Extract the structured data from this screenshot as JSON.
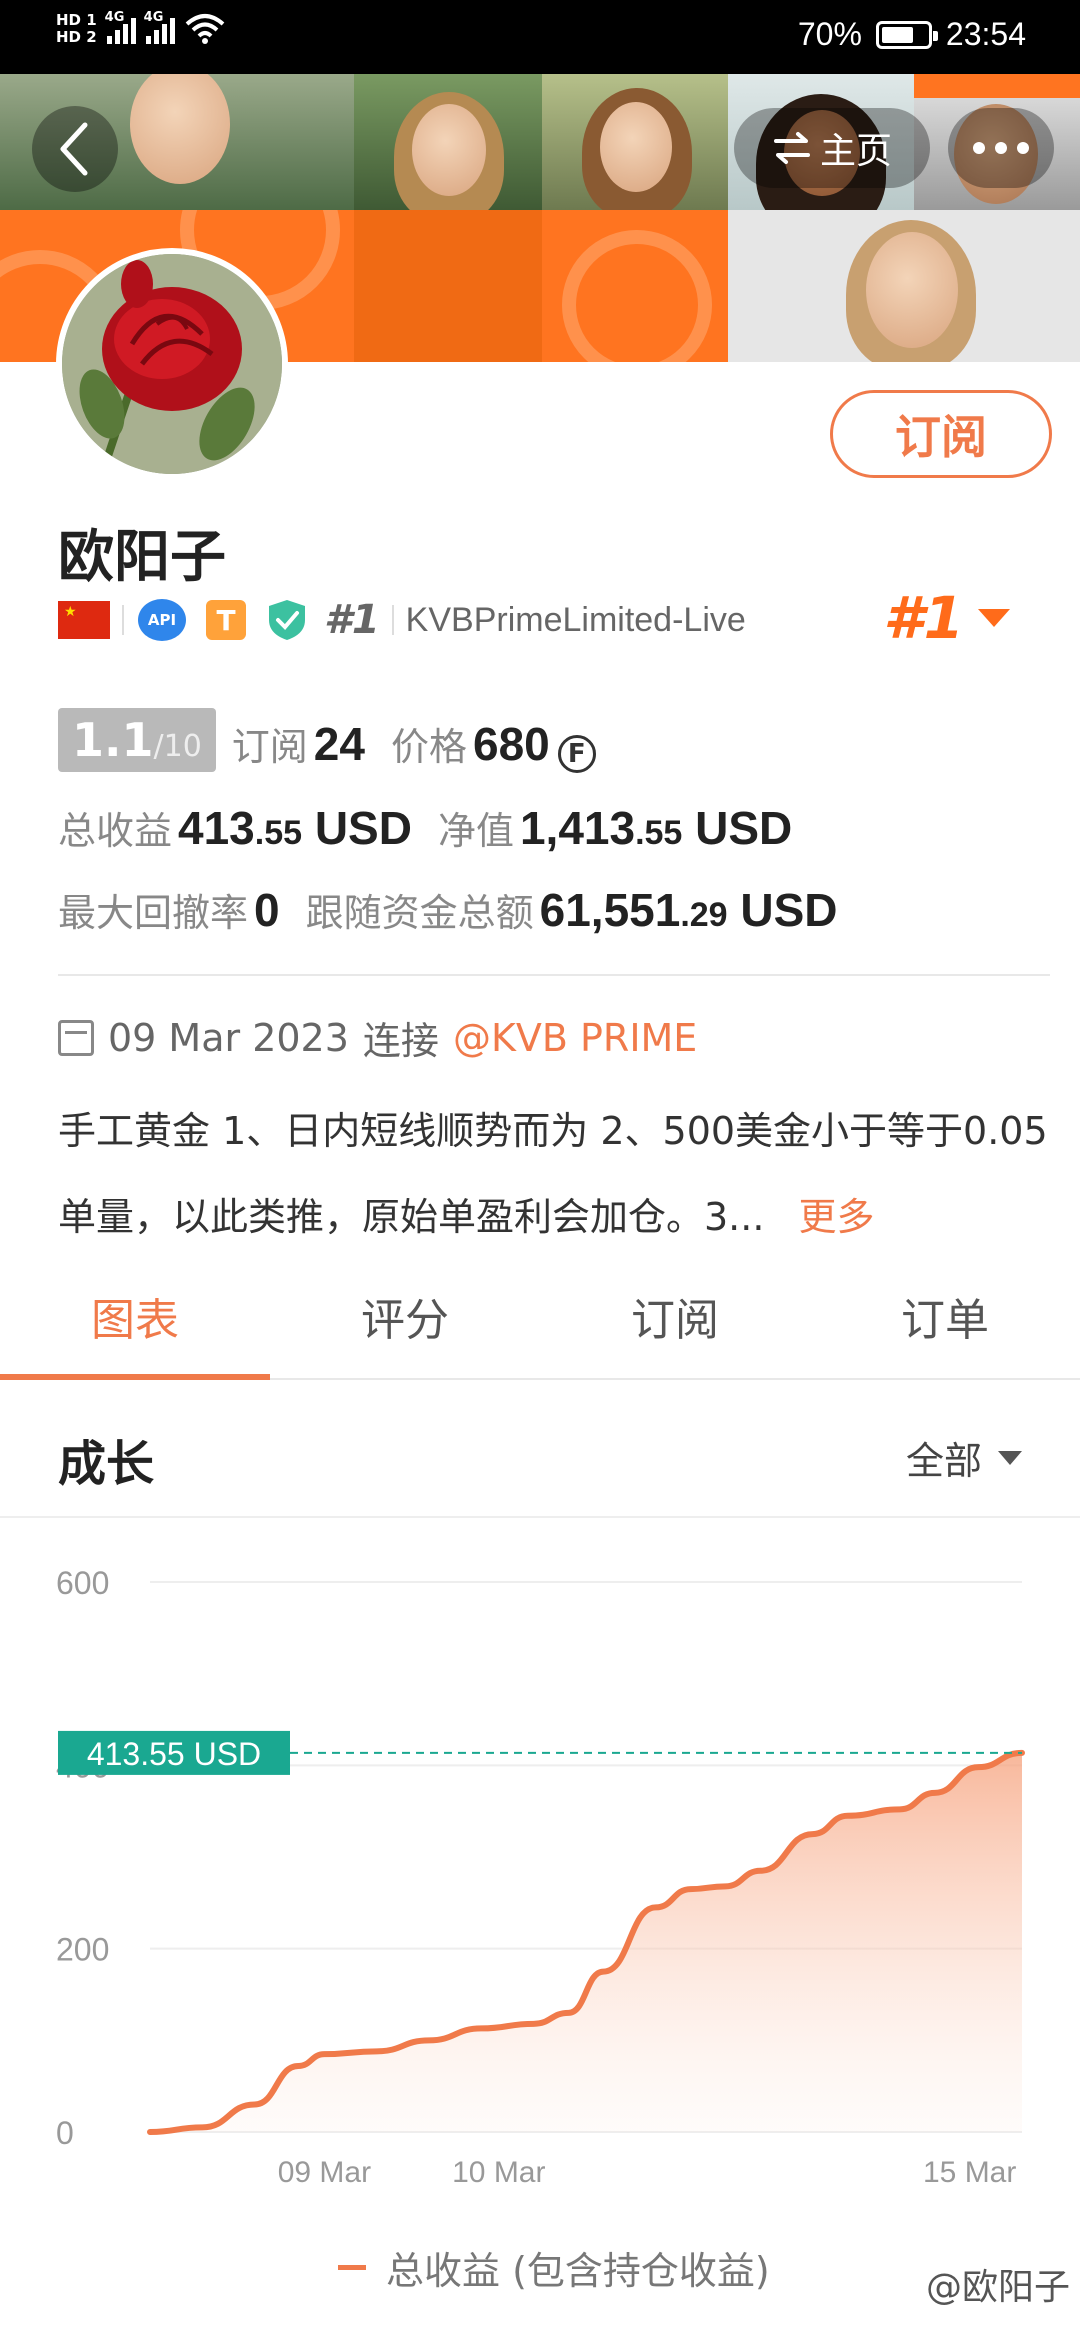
{
  "status_bar": {
    "battery": "70%",
    "time": "23:54",
    "net1": "4G",
    "net2": "4G",
    "hd1": "HD 1",
    "hd2": "HD 2",
    "battery_level": 0.7
  },
  "header": {
    "home_label": "主页"
  },
  "profile": {
    "name": "欧阳子",
    "subscribe_label": "订阅",
    "rank_small": "#1",
    "broker": "KVBPrimeLimited-Live",
    "rank_big": "#1",
    "api_badge": "API",
    "t_badge": "T"
  },
  "stats": {
    "score_main": "1.1",
    "score_total": "/10",
    "subs_label": "订阅",
    "subs_value": "24",
    "price_label": "价格",
    "price_value": "680",
    "coin_symbol": "F",
    "profit_label": "总收益",
    "profit_int": "413",
    "profit_dec": ".55",
    "profit_unit": "USD",
    "equity_label": "净值",
    "equity_int": "1,413",
    "equity_dec": ".55",
    "equity_unit": "USD",
    "drawdown_label": "最大回撤率",
    "drawdown_value": "0",
    "follow_label": "跟随资金总额",
    "follow_int": "61,551",
    "follow_dec": ".29",
    "follow_unit": "USD"
  },
  "connection": {
    "date": "09 Mar 2023",
    "connect_label": "连接",
    "broker_link": "@KVB PRIME"
  },
  "description": {
    "text": "手工黄金 1、日内短线顺势而为 2、500美金小于等于0.05单量，以此类推，原始单盈利会加仓。3...",
    "more": "更多"
  },
  "tabs": [
    {
      "label": "图表",
      "active": true
    },
    {
      "label": "评分",
      "active": false
    },
    {
      "label": "订阅",
      "active": false
    },
    {
      "label": "订单",
      "active": false
    }
  ],
  "section": {
    "title": "成长",
    "filter": "全部"
  },
  "chart_data": {
    "type": "area",
    "ylim": [
      0,
      600
    ],
    "y_ticks": [
      "600",
      "400",
      "200",
      "0"
    ],
    "x_ticks": [
      "09 Mar",
      "10 Mar",
      "15 Mar"
    ],
    "current_label": "413.55 USD",
    "current_value": 413.55,
    "series": [
      {
        "name": "总收益 (包含持仓收益)",
        "color": "#f07a4a",
        "points": [
          [
            0,
            0
          ],
          [
            0.06,
            5
          ],
          [
            0.12,
            30
          ],
          [
            0.17,
            72
          ],
          [
            0.2,
            85
          ],
          [
            0.26,
            88
          ],
          [
            0.32,
            100
          ],
          [
            0.38,
            113
          ],
          [
            0.44,
            118
          ],
          [
            0.48,
            130
          ],
          [
            0.52,
            175
          ],
          [
            0.58,
            245
          ],
          [
            0.62,
            265
          ],
          [
            0.66,
            268
          ],
          [
            0.7,
            285
          ],
          [
            0.76,
            325
          ],
          [
            0.8,
            345
          ],
          [
            0.86,
            352
          ],
          [
            0.9,
            370
          ],
          [
            0.95,
            398
          ],
          [
            1.0,
            413.55
          ]
        ]
      }
    ],
    "legend": "总收益 (包含持仓收益)"
  },
  "watermark": "@欧阳子"
}
